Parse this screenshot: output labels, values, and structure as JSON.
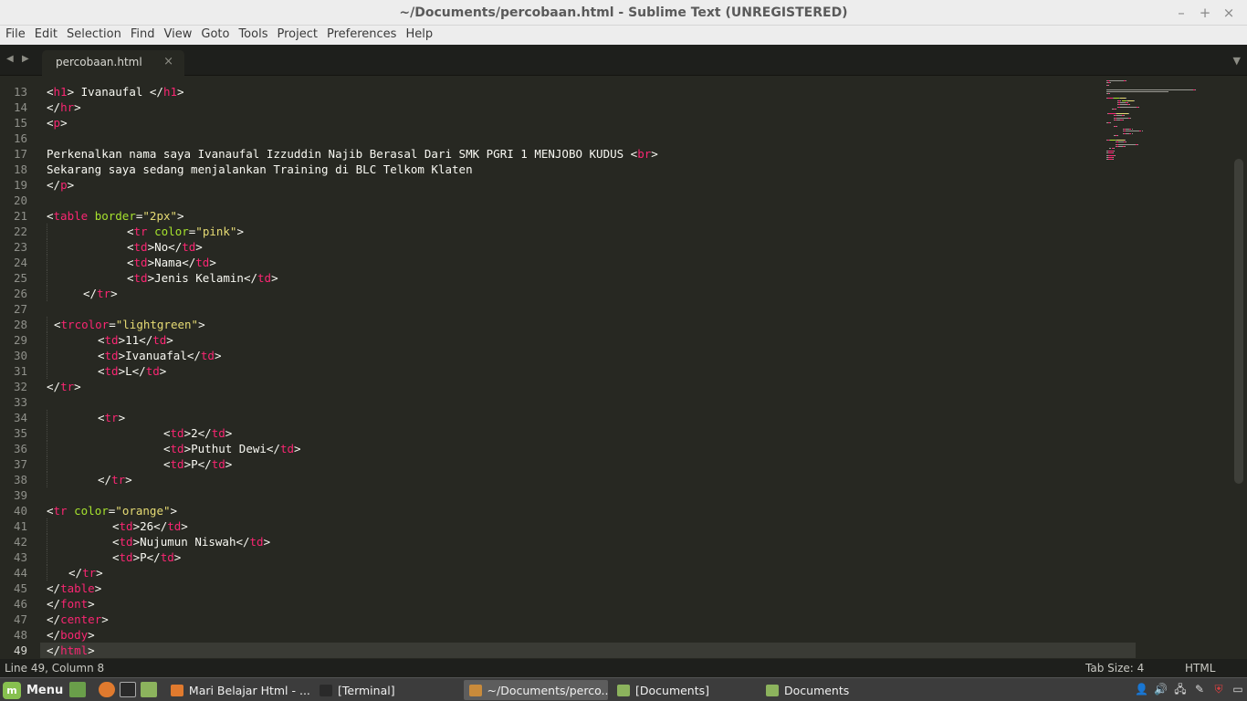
{
  "window": {
    "title": "~/Documents/percobaan.html - Sublime Text (UNREGISTERED)"
  },
  "window_controls": [
    "–",
    "+",
    "×"
  ],
  "menu": [
    "File",
    "Edit",
    "Selection",
    "Find",
    "View",
    "Goto",
    "Tools",
    "Project",
    "Preferences",
    "Help"
  ],
  "tab": {
    "label": "percobaan.html",
    "close": "×"
  },
  "tabbar": {
    "prev": "◀",
    "next": "▶",
    "menu": "▼"
  },
  "editor": {
    "current_line": 49,
    "lines": [
      {
        "n": "13",
        "indent": 0,
        "parts": [
          [
            "p",
            "<"
          ],
          [
            "t",
            "h1"
          ],
          [
            "p",
            "> Ivanaufal </"
          ],
          [
            "t",
            "h1"
          ],
          [
            "p",
            ">"
          ]
        ]
      },
      {
        "n": "14",
        "indent": 0,
        "parts": [
          [
            "p",
            "</"
          ],
          [
            "t",
            "hr"
          ],
          [
            "p",
            ">"
          ]
        ]
      },
      {
        "n": "15",
        "indent": 0,
        "parts": [
          [
            "p",
            "<"
          ],
          [
            "t",
            "p"
          ],
          [
            "p",
            ">"
          ]
        ]
      },
      {
        "n": "16",
        "indent": 0,
        "parts": []
      },
      {
        "n": "17",
        "indent": 0,
        "parts": [
          [
            "p",
            "Perkenalkan nama saya Ivanaufal Izzuddin Najib Berasal Dari SMK PGRI 1 MENJOBO KUDUS <"
          ],
          [
            "t",
            "br"
          ],
          [
            "p",
            ">"
          ]
        ]
      },
      {
        "n": "18",
        "indent": 0,
        "parts": [
          [
            "p",
            "Sekarang saya sedang menjalankan Training di BLC Telkom Klaten"
          ]
        ]
      },
      {
        "n": "19",
        "indent": 0,
        "parts": [
          [
            "p",
            "</"
          ],
          [
            "t",
            "p"
          ],
          [
            "p",
            ">"
          ]
        ]
      },
      {
        "n": "20",
        "indent": 0,
        "parts": []
      },
      {
        "n": "21",
        "indent": 0,
        "parts": [
          [
            "p",
            "<"
          ],
          [
            "t",
            "table"
          ],
          [
            "p",
            " "
          ],
          [
            "a",
            "border"
          ],
          [
            "p",
            "="
          ],
          [
            "s",
            "\"2px\""
          ],
          [
            "p",
            ">"
          ]
        ]
      },
      {
        "n": "22",
        "indent": 11,
        "parts": [
          [
            "p",
            "<"
          ],
          [
            "t",
            "tr"
          ],
          [
            "p",
            " "
          ],
          [
            "a",
            "color"
          ],
          [
            "p",
            "="
          ],
          [
            "s",
            "\"pink\""
          ],
          [
            "p",
            ">"
          ]
        ]
      },
      {
        "n": "23",
        "indent": 11,
        "parts": [
          [
            "p",
            "<"
          ],
          [
            "t",
            "td"
          ],
          [
            "p",
            ">No</"
          ],
          [
            "t",
            "td"
          ],
          [
            "p",
            ">"
          ]
        ]
      },
      {
        "n": "24",
        "indent": 11,
        "parts": [
          [
            "p",
            "<"
          ],
          [
            "t",
            "td"
          ],
          [
            "p",
            ">Nama</"
          ],
          [
            "t",
            "td"
          ],
          [
            "p",
            ">"
          ]
        ]
      },
      {
        "n": "25",
        "indent": 11,
        "parts": [
          [
            "p",
            "<"
          ],
          [
            "t",
            "td"
          ],
          [
            "p",
            ">Jenis Kelamin</"
          ],
          [
            "t",
            "td"
          ],
          [
            "p",
            ">"
          ]
        ]
      },
      {
        "n": "26",
        "indent": 5,
        "parts": [
          [
            "p",
            "</"
          ],
          [
            "t",
            "tr"
          ],
          [
            "p",
            ">"
          ]
        ]
      },
      {
        "n": "27",
        "indent": 0,
        "parts": []
      },
      {
        "n": "28",
        "indent": 1,
        "parts": [
          [
            "p",
            "<"
          ],
          [
            "t",
            "trcolor"
          ],
          [
            "p",
            "="
          ],
          [
            "s",
            "\"lightgreen\""
          ],
          [
            "p",
            ">"
          ]
        ]
      },
      {
        "n": "29",
        "indent": 7,
        "parts": [
          [
            "p",
            "<"
          ],
          [
            "t",
            "td"
          ],
          [
            "p",
            ">11</"
          ],
          [
            "t",
            "td"
          ],
          [
            "p",
            ">"
          ]
        ]
      },
      {
        "n": "30",
        "indent": 7,
        "parts": [
          [
            "p",
            "<"
          ],
          [
            "t",
            "td"
          ],
          [
            "p",
            ">Ivanuafal</"
          ],
          [
            "t",
            "td"
          ],
          [
            "p",
            ">"
          ]
        ]
      },
      {
        "n": "31",
        "indent": 7,
        "parts": [
          [
            "p",
            "<"
          ],
          [
            "t",
            "td"
          ],
          [
            "p",
            ">L</"
          ],
          [
            "t",
            "td"
          ],
          [
            "p",
            ">"
          ]
        ]
      },
      {
        "n": "32",
        "indent": 0,
        "parts": [
          [
            "p",
            "</"
          ],
          [
            "t",
            "tr"
          ],
          [
            "p",
            ">"
          ]
        ]
      },
      {
        "n": "33",
        "indent": 0,
        "parts": []
      },
      {
        "n": "34",
        "indent": 7,
        "parts": [
          [
            "p",
            "<"
          ],
          [
            "t",
            "tr"
          ],
          [
            "p",
            ">"
          ]
        ]
      },
      {
        "n": "35",
        "indent": 16,
        "parts": [
          [
            "p",
            "<"
          ],
          [
            "t",
            "td"
          ],
          [
            "p",
            ">2</"
          ],
          [
            "t",
            "td"
          ],
          [
            "p",
            ">"
          ]
        ]
      },
      {
        "n": "36",
        "indent": 16,
        "parts": [
          [
            "p",
            "<"
          ],
          [
            "t",
            "td"
          ],
          [
            "p",
            ">Puthut Dewi</"
          ],
          [
            "t",
            "td"
          ],
          [
            "p",
            ">"
          ]
        ]
      },
      {
        "n": "37",
        "indent": 16,
        "parts": [
          [
            "p",
            "<"
          ],
          [
            "t",
            "td"
          ],
          [
            "p",
            ">P</"
          ],
          [
            "t",
            "td"
          ],
          [
            "p",
            ">"
          ]
        ]
      },
      {
        "n": "38",
        "indent": 7,
        "parts": [
          [
            "p",
            "</"
          ],
          [
            "t",
            "tr"
          ],
          [
            "p",
            ">"
          ]
        ]
      },
      {
        "n": "39",
        "indent": 0,
        "parts": []
      },
      {
        "n": "40",
        "indent": 0,
        "parts": [
          [
            "p",
            "<"
          ],
          [
            "t",
            "tr"
          ],
          [
            "p",
            " "
          ],
          [
            "a",
            "color"
          ],
          [
            "p",
            "="
          ],
          [
            "s",
            "\"orange\""
          ],
          [
            "p",
            ">"
          ]
        ]
      },
      {
        "n": "41",
        "indent": 9,
        "parts": [
          [
            "p",
            "<"
          ],
          [
            "t",
            "td"
          ],
          [
            "p",
            ">26</"
          ],
          [
            "t",
            "td"
          ],
          [
            "p",
            ">"
          ]
        ]
      },
      {
        "n": "42",
        "indent": 9,
        "parts": [
          [
            "p",
            "<"
          ],
          [
            "t",
            "td"
          ],
          [
            "p",
            ">Nujumun Niswah</"
          ],
          [
            "t",
            "td"
          ],
          [
            "p",
            ">"
          ]
        ]
      },
      {
        "n": "43",
        "indent": 9,
        "parts": [
          [
            "p",
            "<"
          ],
          [
            "t",
            "td"
          ],
          [
            "p",
            ">P</"
          ],
          [
            "t",
            "td"
          ],
          [
            "p",
            ">"
          ]
        ]
      },
      {
        "n": "44",
        "indent": 3,
        "parts": [
          [
            "p",
            "</"
          ],
          [
            "t",
            "tr"
          ],
          [
            "p",
            ">"
          ]
        ]
      },
      {
        "n": "45",
        "indent": 0,
        "parts": [
          [
            "p",
            "</"
          ],
          [
            "t",
            "table"
          ],
          [
            "p",
            ">"
          ]
        ]
      },
      {
        "n": "46",
        "indent": 0,
        "parts": [
          [
            "p",
            "</"
          ],
          [
            "t",
            "font"
          ],
          [
            "p",
            ">"
          ]
        ]
      },
      {
        "n": "47",
        "indent": 0,
        "parts": [
          [
            "p",
            "</"
          ],
          [
            "t",
            "center"
          ],
          [
            "p",
            ">"
          ]
        ]
      },
      {
        "n": "48",
        "indent": 0,
        "parts": [
          [
            "p",
            "</"
          ],
          [
            "t",
            "body"
          ],
          [
            "p",
            ">"
          ]
        ]
      },
      {
        "n": "49",
        "indent": 0,
        "parts": [
          [
            "p",
            "</"
          ],
          [
            "t",
            "html"
          ],
          [
            "p",
            ">"
          ]
        ]
      }
    ]
  },
  "colors": {
    "tag": "#f92672",
    "attr": "#a6e22e",
    "string": "#e6db74",
    "text": "#f8f8f2"
  },
  "status": {
    "position": "Line 49, Column 8",
    "tab_size": "Tab Size: 4",
    "syntax": "HTML"
  },
  "taskbar": {
    "menu_label": "Menu",
    "menu_icon": "linux-mint-logo-icon",
    "launchers": [
      "show-desktop-icon",
      "firefox-icon",
      "terminal-icon",
      "files-icon"
    ],
    "windows": [
      {
        "label": "Mari Belajar Html - ...",
        "icon": "firefox-icon",
        "active": false
      },
      {
        "label": "[Terminal]",
        "icon": "terminal-icon",
        "active": false
      },
      {
        "label": "~/Documents/perco...",
        "icon": "sublime-text-icon",
        "active": true
      },
      {
        "label": "[Documents]",
        "icon": "folder-icon",
        "active": false
      },
      {
        "label": "Documents",
        "icon": "folder-icon",
        "active": false
      }
    ],
    "tray": [
      "user-icon",
      "volume-icon",
      "network-icon",
      "pen-icon",
      "shield-icon",
      "display-icon"
    ]
  }
}
